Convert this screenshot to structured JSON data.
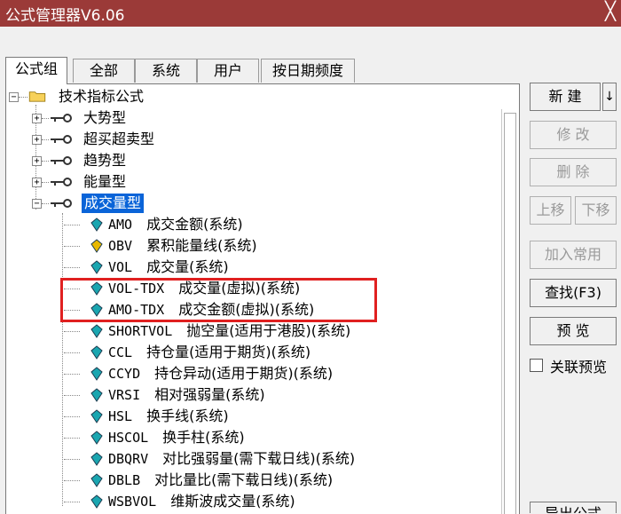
{
  "window": {
    "title": "公式管理器V6.06",
    "close_glyph": "╳"
  },
  "tabs": [
    "公式组",
    "全部",
    "系统",
    "用户",
    "按日期频度"
  ],
  "tree": {
    "root": "技术指标公式",
    "groups": [
      "大势型",
      "超买超卖型",
      "趋势型",
      "能量型",
      "成交量型"
    ],
    "items": [
      {
        "code": "AMO",
        "name": "成交金额(系统)"
      },
      {
        "code": "OBV",
        "name": "累积能量线(系统)"
      },
      {
        "code": "VOL",
        "name": "成交量(系统)"
      },
      {
        "code": "VOL-TDX",
        "name": "成交量(虚拟)(系统)"
      },
      {
        "code": "AMO-TDX",
        "name": "成交金额(虚拟)(系统)"
      },
      {
        "code": "SHORTVOL",
        "name": "抛空量(适用于港股)(系统)"
      },
      {
        "code": "CCL",
        "name": "持仓量(适用于期货)(系统)"
      },
      {
        "code": "CCYD",
        "name": "持仓异动(适用于期货)(系统)"
      },
      {
        "code": "VRSI",
        "name": "相对强弱量(系统)"
      },
      {
        "code": "HSL",
        "name": "换手线(系统)"
      },
      {
        "code": "HSCOL",
        "name": "换手柱(系统)"
      },
      {
        "code": "DBQRV",
        "name": "对比强弱量(需下载日线)(系统)"
      },
      {
        "code": "DBLB",
        "name": "对比量比(需下载日线)(系统)"
      },
      {
        "code": "WSBVOL",
        "name": "维斯波成交量(系统)"
      }
    ]
  },
  "buttons": {
    "new": "新  建",
    "new_arrow": "↓",
    "modify": "修  改",
    "delete": "删  除",
    "move_up": "上移",
    "move_down": "下移",
    "add_common": "加入常用",
    "find": "查找(F3)",
    "preview": "预  览",
    "export": "导出公式"
  },
  "checkbox": {
    "label": "关联预览",
    "checked": false
  },
  "colors": {
    "title_bg": "#9b3a38",
    "selection": "#0a64d8",
    "highlight_box": "#e02020",
    "gem_teal": "#1aa6b0",
    "gem_yellow": "#e8b800"
  }
}
